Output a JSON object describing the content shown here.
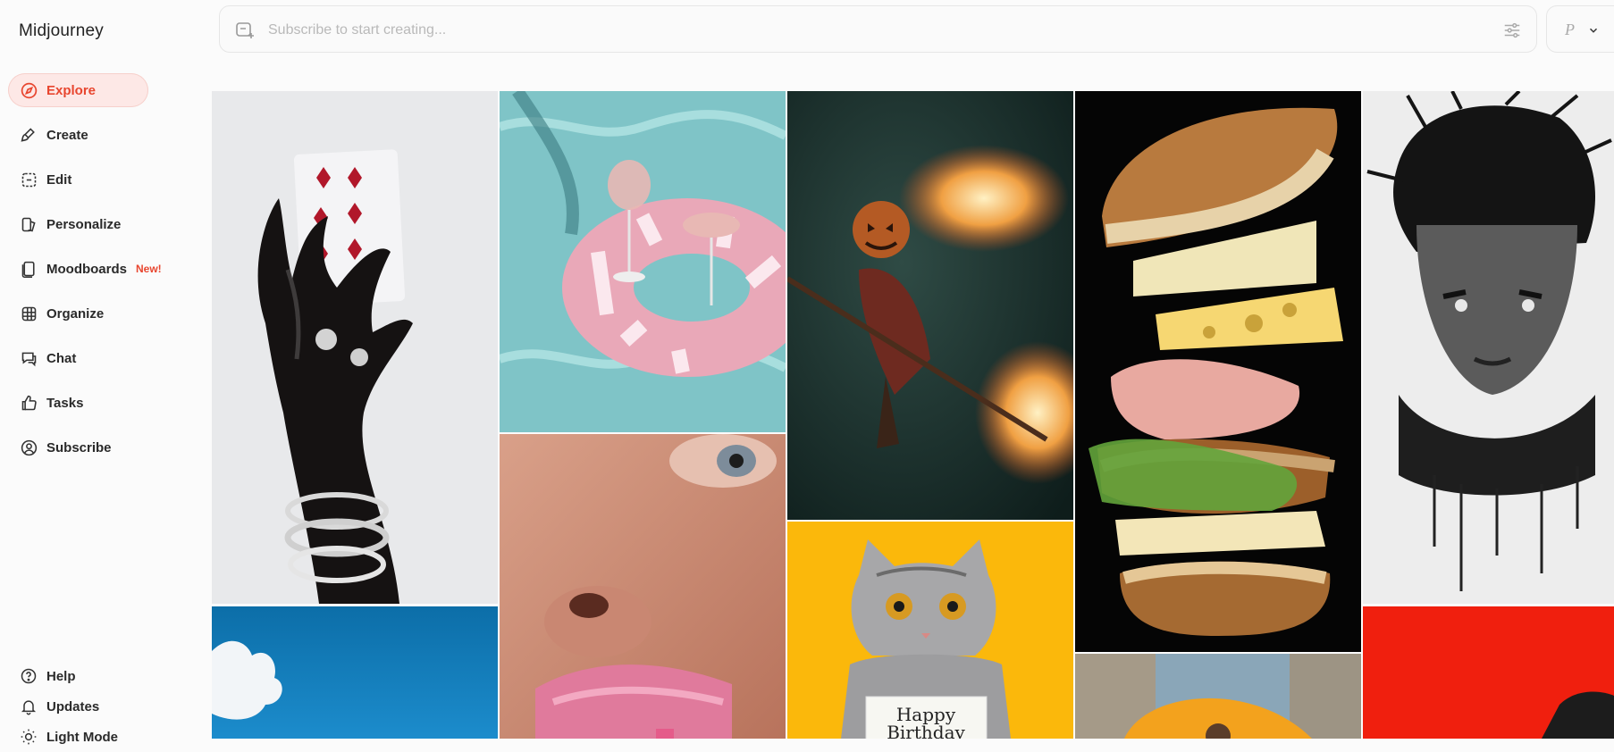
{
  "app": {
    "title": "Midjourney"
  },
  "nav": {
    "items": [
      {
        "label": "Explore",
        "icon": "compass-icon"
      },
      {
        "label": "Create",
        "icon": "brush-icon"
      },
      {
        "label": "Edit",
        "icon": "edit-icon"
      },
      {
        "label": "Personalize",
        "icon": "personalize-icon"
      },
      {
        "label": "Moodboards",
        "icon": "moodboard-icon",
        "badge": "New!"
      },
      {
        "label": "Organize",
        "icon": "grid-icon"
      },
      {
        "label": "Chat",
        "icon": "chat-icon"
      },
      {
        "label": "Tasks",
        "icon": "thumbs-up-icon"
      },
      {
        "label": "Subscribe",
        "icon": "user-circle-icon"
      }
    ],
    "bottom": [
      {
        "label": "Help",
        "icon": "help-icon"
      },
      {
        "label": "Updates",
        "icon": "bell-icon"
      },
      {
        "label": "Light Mode",
        "icon": "sun-icon"
      }
    ]
  },
  "search": {
    "placeholder": "Subscribe to start creating..."
  },
  "profile": {
    "letter": "P"
  },
  "colors": {
    "accent": "#e8462f",
    "active_bg": "#fde8e6"
  },
  "gallery": {
    "tiles": [
      {
        "name": "image-tile-glove-card"
      },
      {
        "name": "image-tile-pool-float"
      },
      {
        "name": "image-tile-pumpkin-witch"
      },
      {
        "name": "image-tile-sandwich"
      },
      {
        "name": "image-tile-ink-portrait"
      },
      {
        "name": "image-tile-sky-clouds"
      },
      {
        "name": "image-tile-lips-closeup"
      },
      {
        "name": "image-tile-birthday-cat",
        "caption_lines": [
          "Happy",
          "Birthday"
        ]
      },
      {
        "name": "image-tile-umbrella"
      },
      {
        "name": "image-tile-red"
      }
    ]
  }
}
